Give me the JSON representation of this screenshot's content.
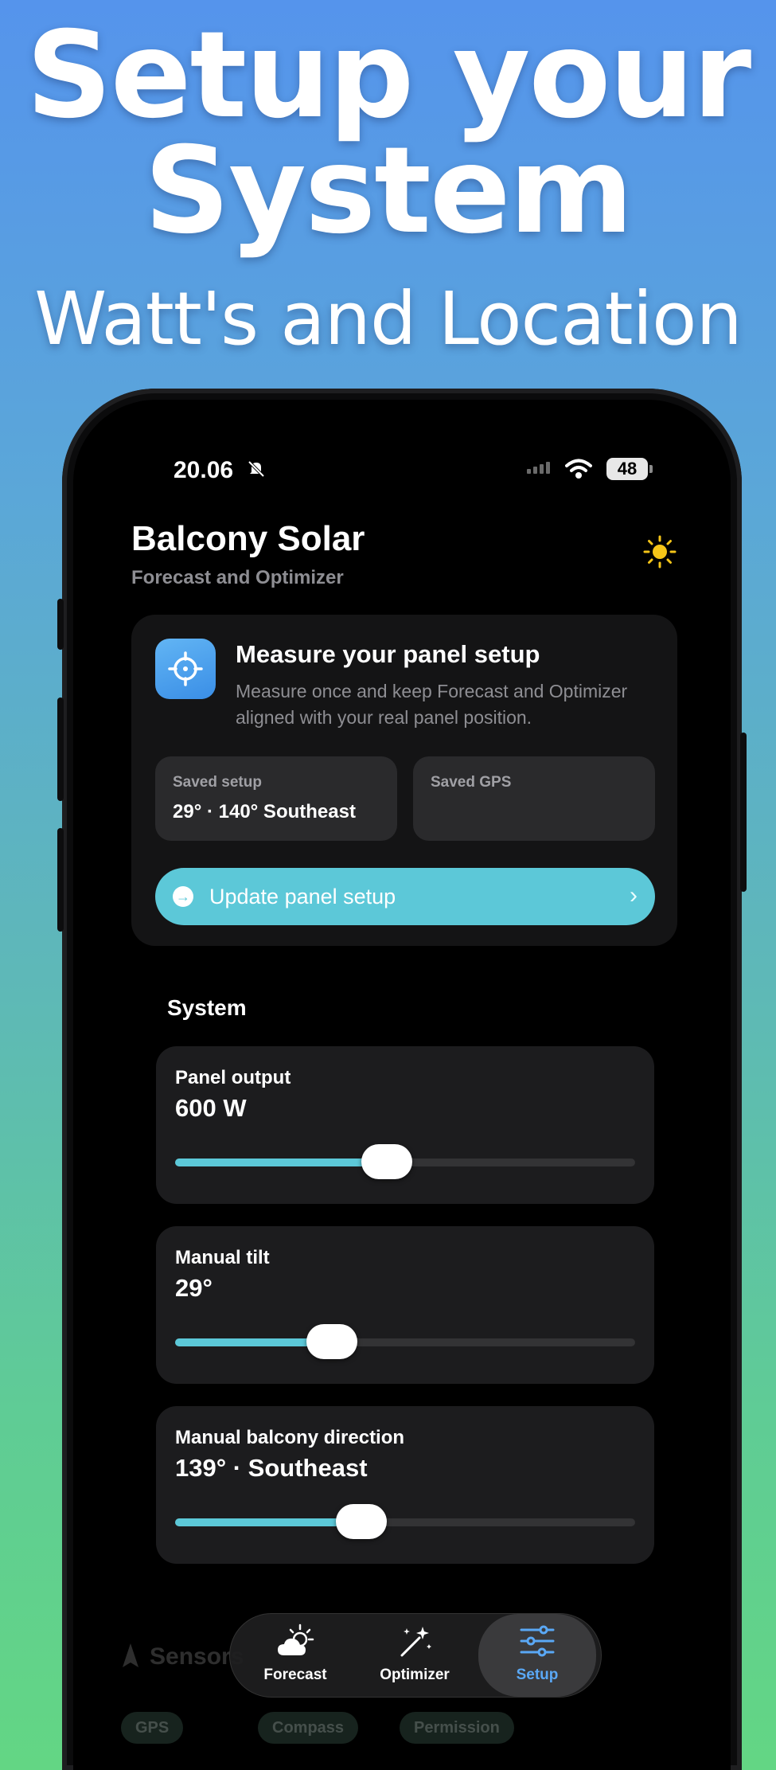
{
  "promo": {
    "line1": "Setup your",
    "line2": "System",
    "line3": "Watt's and Location"
  },
  "status_bar": {
    "time": "20.06",
    "battery": "48"
  },
  "header": {
    "title": "Balcony Solar",
    "subtitle": "Forecast and Optimizer",
    "theme_icon": "sun-icon"
  },
  "measure_card": {
    "title": "Measure your panel setup",
    "description": "Measure once and keep Forecast and Optimizer aligned with your real panel position.",
    "saved_setup_label": "Saved setup",
    "saved_setup_value": "29° · 140° Southeast",
    "saved_gps_label": "Saved GPS",
    "saved_gps_value": "",
    "update_button": "Update panel setup"
  },
  "system": {
    "section_title": "System",
    "sliders": [
      {
        "label": "Panel output",
        "value": "600 W",
        "fraction": 0.46
      },
      {
        "label": "Manual tilt",
        "value": "29°",
        "fraction": 0.34
      },
      {
        "label": "Manual balcony direction",
        "value": "139° · Southeast",
        "fraction": 0.405
      }
    ]
  },
  "sensors": {
    "title": "Sensors",
    "chips": [
      "GPS",
      "Compass",
      "Permission"
    ]
  },
  "tabs": [
    {
      "label": "Forecast",
      "icon": "cloud-sun-icon",
      "active": false
    },
    {
      "label": "Optimizer",
      "icon": "magic-wand-icon",
      "active": false
    },
    {
      "label": "Setup",
      "icon": "sliders-icon",
      "active": true
    }
  ],
  "colors": {
    "accent": "#5cc8d8",
    "active_tab": "#5aa8f5",
    "sun": "#f5c518"
  }
}
